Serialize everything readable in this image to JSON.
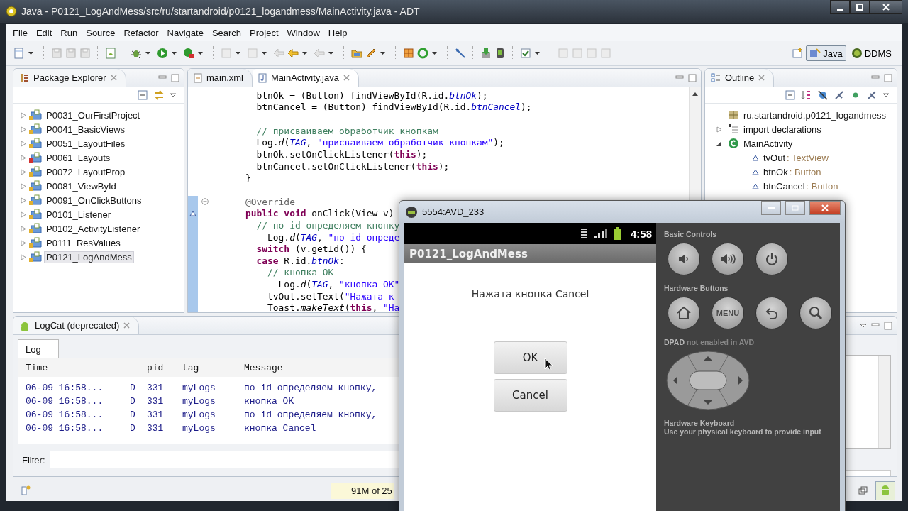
{
  "window": {
    "title": "Java - P0121_LogAndMess/src/ru/startandroid/p0121_logandmess/MainActivity.java - ADT"
  },
  "menu": [
    "File",
    "Edit",
    "Run",
    "Source",
    "Refactor",
    "Navigate",
    "Search",
    "Project",
    "Window",
    "Help"
  ],
  "perspectives": [
    {
      "label": "Java",
      "selected": true
    },
    {
      "label": "DDMS",
      "selected": false
    }
  ],
  "package_explorer": {
    "title": "Package Explorer",
    "items": [
      {
        "label": "P0031_OurFirstProject",
        "selected": false,
        "error": false
      },
      {
        "label": "P0041_BasicViews",
        "selected": false,
        "error": false
      },
      {
        "label": "P0051_LayoutFiles",
        "selected": false,
        "error": false
      },
      {
        "label": "P0061_Layouts",
        "selected": false,
        "error": true
      },
      {
        "label": "P0072_LayoutProp",
        "selected": false,
        "error": false
      },
      {
        "label": "P0081_ViewById",
        "selected": false,
        "error": false
      },
      {
        "label": "P0091_OnClickButtons",
        "selected": false,
        "error": false
      },
      {
        "label": "P0101_Listener",
        "selected": false,
        "error": false
      },
      {
        "label": "P0102_ActivityListener",
        "selected": false,
        "error": false
      },
      {
        "label": "P0111_ResValues",
        "selected": false,
        "error": false
      },
      {
        "label": "P0121_LogAndMess",
        "selected": true,
        "error": false
      }
    ]
  },
  "editor": {
    "tabs": [
      {
        "label": "main.xml",
        "selected": false,
        "kind": "xml"
      },
      {
        "label": "MainActivity.java",
        "selected": true,
        "kind": "java"
      }
    ],
    "lines": [
      {
        "kind": "code",
        "range": false,
        "fold": false,
        "marker": false,
        "segments": [
          {
            "kind": "plain",
            "text": "      btnOk = (Button) findViewById(R.id."
          },
          {
            "kind": "field",
            "text": "btnOk"
          },
          {
            "kind": "plain",
            "text": ");"
          }
        ]
      },
      {
        "kind": "code",
        "range": false,
        "fold": false,
        "marker": false,
        "segments": [
          {
            "kind": "plain",
            "text": "      btnCancel = (Button) findViewById(R.id."
          },
          {
            "kind": "field",
            "text": "btnCancel"
          },
          {
            "kind": "plain",
            "text": ");"
          }
        ]
      },
      {
        "kind": "blank",
        "range": false,
        "fold": false,
        "marker": false
      },
      {
        "kind": "code",
        "range": false,
        "fold": false,
        "marker": false,
        "segments": [
          {
            "kind": "comment",
            "text": "      // присваиваем обработчик кнопкам"
          }
        ]
      },
      {
        "kind": "code",
        "range": false,
        "fold": false,
        "marker": false,
        "segments": [
          {
            "kind": "plain",
            "text": "      Log."
          },
          {
            "kind": "static",
            "text": "d"
          },
          {
            "kind": "plain",
            "text": "("
          },
          {
            "kind": "field",
            "text": "TAG"
          },
          {
            "kind": "plain",
            "text": ", "
          },
          {
            "kind": "str",
            "text": "\"присваиваем обработчик кнопкам\""
          },
          {
            "kind": "plain",
            "text": ");"
          }
        ]
      },
      {
        "kind": "code",
        "range": false,
        "fold": false,
        "marker": false,
        "segments": [
          {
            "kind": "plain",
            "text": "      btnOk.setOnClickListener("
          },
          {
            "kind": "kw",
            "text": "this"
          },
          {
            "kind": "plain",
            "text": ");"
          }
        ]
      },
      {
        "kind": "code",
        "range": false,
        "fold": false,
        "marker": false,
        "segments": [
          {
            "kind": "plain",
            "text": "      btnCancel.setOnClickListener("
          },
          {
            "kind": "kw",
            "text": "this"
          },
          {
            "kind": "plain",
            "text": ");"
          }
        ]
      },
      {
        "kind": "code",
        "range": false,
        "fold": false,
        "marker": false,
        "segments": [
          {
            "kind": "plain",
            "text": "    }"
          }
        ]
      },
      {
        "kind": "blank",
        "range": false,
        "fold": false,
        "marker": false
      },
      {
        "kind": "code",
        "range": true,
        "fold": true,
        "marker": false,
        "segments": [
          {
            "kind": "annot",
            "text": "    @Override"
          }
        ]
      },
      {
        "kind": "code",
        "range": true,
        "fold": false,
        "marker": true,
        "segments": [
          {
            "kind": "kw",
            "text": "    public"
          },
          {
            "kind": "kw",
            "text": " void"
          },
          {
            "kind": "plain",
            "text": " onClick(View v)"
          }
        ]
      },
      {
        "kind": "code",
        "range": true,
        "fold": false,
        "marker": false,
        "segments": [
          {
            "kind": "comment",
            "text": "      // по id определяем кнопку"
          }
        ]
      },
      {
        "kind": "code",
        "range": true,
        "fold": false,
        "marker": false,
        "segments": [
          {
            "kind": "plain",
            "text": "        Log."
          },
          {
            "kind": "static",
            "text": "d"
          },
          {
            "kind": "plain",
            "text": "("
          },
          {
            "kind": "field",
            "text": "TAG"
          },
          {
            "kind": "plain",
            "text": ", "
          },
          {
            "kind": "str",
            "text": "\"по id опреде"
          }
        ]
      },
      {
        "kind": "code",
        "range": true,
        "fold": false,
        "marker": false,
        "segments": [
          {
            "kind": "kw",
            "text": "      switch"
          },
          {
            "kind": "plain",
            "text": " (v.getId()) {"
          }
        ]
      },
      {
        "kind": "code",
        "range": true,
        "fold": false,
        "marker": false,
        "segments": [
          {
            "kind": "kw",
            "text": "      case"
          },
          {
            "kind": "plain",
            "text": " R.id."
          },
          {
            "kind": "field",
            "text": "btnOk"
          },
          {
            "kind": "plain",
            "text": ":"
          }
        ]
      },
      {
        "kind": "code",
        "range": true,
        "fold": false,
        "marker": false,
        "segments": [
          {
            "kind": "comment",
            "text": "        // кнопка OK"
          }
        ]
      },
      {
        "kind": "code",
        "range": true,
        "fold": false,
        "marker": false,
        "segments": [
          {
            "kind": "plain",
            "text": "          Log."
          },
          {
            "kind": "static",
            "text": "d"
          },
          {
            "kind": "plain",
            "text": "("
          },
          {
            "kind": "field",
            "text": "TAG"
          },
          {
            "kind": "plain",
            "text": ", "
          },
          {
            "kind": "str",
            "text": "\"кнопка OK\""
          }
        ]
      },
      {
        "kind": "code",
        "range": true,
        "fold": false,
        "marker": false,
        "segments": [
          {
            "kind": "plain",
            "text": "        tvOut.setText("
          },
          {
            "kind": "str",
            "text": "\"Нажата к"
          }
        ]
      },
      {
        "kind": "code",
        "range": true,
        "fold": false,
        "marker": false,
        "segments": [
          {
            "kind": "plain",
            "text": "        Toast."
          },
          {
            "kind": "static",
            "text": "makeText"
          },
          {
            "kind": "plain",
            "text": "("
          },
          {
            "kind": "kw",
            "text": "this"
          },
          {
            "kind": "plain",
            "text": ", "
          },
          {
            "kind": "str",
            "text": "\"На"
          }
        ]
      }
    ]
  },
  "outline": {
    "title": "Outline",
    "items": [
      {
        "kind": "package",
        "label": "ru.startandroid.p0121_logandmess"
      },
      {
        "kind": "imports",
        "label": "import declarations",
        "expanded": false
      },
      {
        "kind": "class",
        "label": "MainActivity",
        "expanded": true,
        "children": [
          {
            "label": "tvOut",
            "type": ": TextView"
          },
          {
            "label": "btnOk",
            "type": ": Button"
          },
          {
            "label": "btnCancel",
            "type": ": Button"
          }
        ]
      }
    ]
  },
  "logcat": {
    "title": "LogCat (deprecated)",
    "tab": "Log",
    "columns": [
      "Time",
      "pid",
      "tag",
      "Message"
    ],
    "rows": [
      {
        "time": "06-09 16:58...",
        "level": "D",
        "pid": "331",
        "tag": "myLogs",
        "message": "по id определяем кнопку,"
      },
      {
        "time": "06-09 16:58...",
        "level": "D",
        "pid": "331",
        "tag": "myLogs",
        "message": "кнопка OK"
      },
      {
        "time": "06-09 16:58...",
        "level": "D",
        "pid": "331",
        "tag": "myLogs",
        "message": "по id определяем кнопку,"
      },
      {
        "time": "06-09 16:58...",
        "level": "D",
        "pid": "331",
        "tag": "myLogs",
        "message": "кнопка Cancel"
      }
    ],
    "filter_label": "Filter:"
  },
  "status_bar": {
    "heap": "91M of 25"
  },
  "emulator": {
    "title": "5554:AVD_233",
    "clock": "4:58",
    "app_title": "P0121_LogAndMess",
    "message": "Нажата кнопка Cancel",
    "buttons": [
      "OK",
      "Cancel"
    ],
    "basic_controls": "Basic Controls",
    "hardware_buttons": "Hardware Buttons",
    "menu_key": "MENU",
    "dpad_title": "DPAD",
    "dpad_note": "not enabled in AVD",
    "keyboard_title": "Hardware Keyboard",
    "keyboard_note": "Use your physical keyboard to provide input"
  }
}
